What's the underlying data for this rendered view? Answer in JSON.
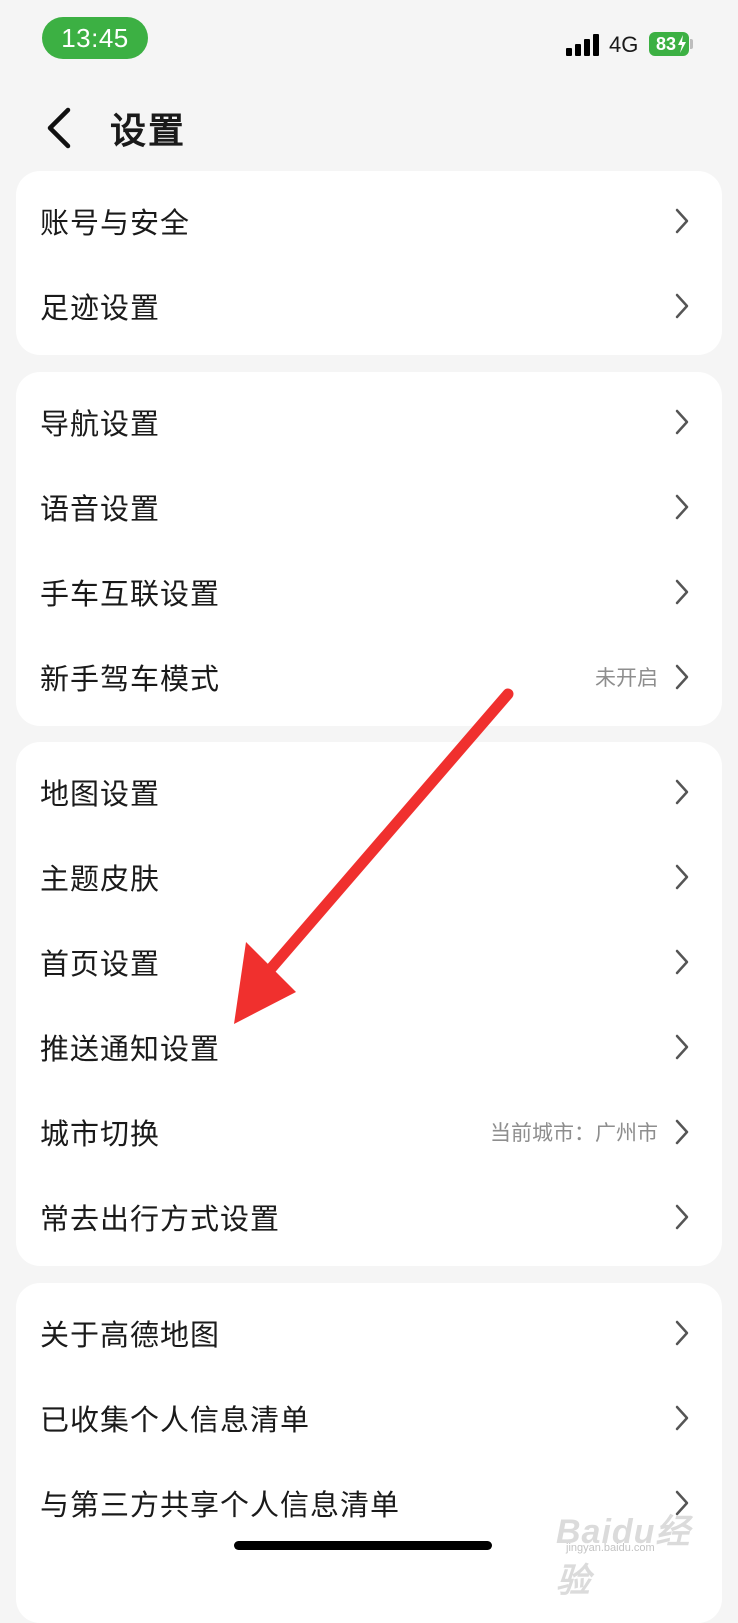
{
  "status_bar": {
    "time": "13:45",
    "network": "4G",
    "battery": "83"
  },
  "header": {
    "back_icon": "chevron-left-icon",
    "title": "设置"
  },
  "groups": [
    {
      "items": [
        {
          "label": "账号与安全",
          "value": ""
        },
        {
          "label": "足迹设置",
          "value": ""
        }
      ]
    },
    {
      "items": [
        {
          "label": "导航设置",
          "value": ""
        },
        {
          "label": "语音设置",
          "value": ""
        },
        {
          "label": "手车互联设置",
          "value": ""
        },
        {
          "label": "新手驾车模式",
          "value": "未开启"
        }
      ]
    },
    {
      "items": [
        {
          "label": "地图设置",
          "value": ""
        },
        {
          "label": "主题皮肤",
          "value": ""
        },
        {
          "label": "首页设置",
          "value": ""
        },
        {
          "label": "推送通知设置",
          "value": ""
        },
        {
          "label": "城市切换",
          "value": "当前城市：广州市"
        },
        {
          "label": "常去出行方式设置",
          "value": ""
        }
      ]
    },
    {
      "items": [
        {
          "label": "关于高德地图",
          "value": ""
        },
        {
          "label": "已收集个人信息清单",
          "value": ""
        },
        {
          "label": "与第三方共享个人信息清单",
          "value": ""
        }
      ]
    }
  ],
  "watermark": {
    "text": "Baidu经验",
    "sub": "jingyan.baidu.com"
  },
  "colors": {
    "background": "#f5f5f5",
    "card": "#ffffff",
    "status_green": "#3cb043",
    "annotation_arrow": "#f0302e",
    "secondary_text": "#8e8e8e"
  }
}
